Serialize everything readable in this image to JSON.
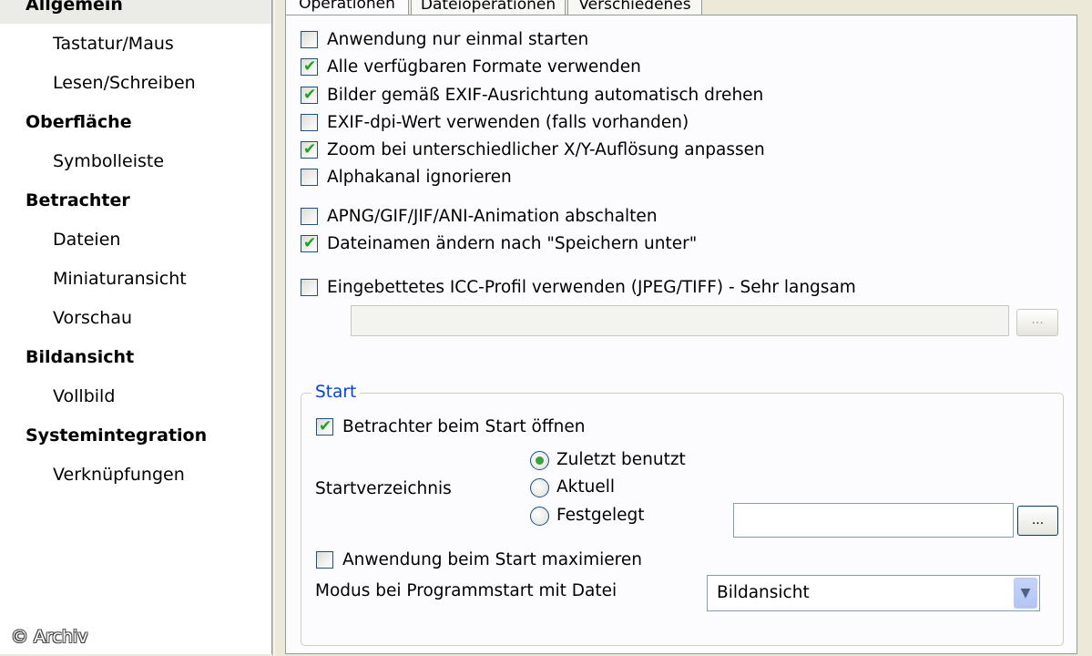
{
  "sidebar": {
    "items": [
      {
        "label": "Allgemein",
        "level": "category",
        "selected": true
      },
      {
        "label": "Tastatur/Maus",
        "level": "sub"
      },
      {
        "label": "Lesen/Schreiben",
        "level": "sub"
      },
      {
        "label": "Oberfläche",
        "level": "category"
      },
      {
        "label": "Symbolleiste",
        "level": "sub"
      },
      {
        "label": "Betrachter",
        "level": "category"
      },
      {
        "label": "Dateien",
        "level": "sub"
      },
      {
        "label": "Miniaturansicht",
        "level": "sub"
      },
      {
        "label": "Vorschau",
        "level": "sub"
      },
      {
        "label": "Bildansicht",
        "level": "category"
      },
      {
        "label": "Vollbild",
        "level": "sub"
      },
      {
        "label": "Systemintegration",
        "level": "category"
      },
      {
        "label": "Verknüpfungen",
        "level": "sub"
      }
    ]
  },
  "tabs": [
    {
      "label": "Operationen",
      "active": true
    },
    {
      "label": "Dateioperationen",
      "active": false
    },
    {
      "label": "Verschiedenes",
      "active": false
    }
  ],
  "options": [
    {
      "label": "Anwendung nur einmal starten",
      "checked": false
    },
    {
      "label": "Alle verfügbaren Formate verwenden",
      "checked": true
    },
    {
      "label": "Bilder gemäß EXIF-Ausrichtung automatisch drehen",
      "checked": true
    },
    {
      "label": "EXIF-dpi-Wert verwenden (falls vorhanden)",
      "checked": false
    },
    {
      "label": "Zoom bei unterschiedlicher X/Y-Auflösung anpassen",
      "checked": true
    },
    {
      "label": "Alphakanal ignorieren",
      "checked": false
    },
    {
      "label": "APNG/GIF/JIF/ANI-Animation abschalten",
      "checked": false
    },
    {
      "label": "Dateinamen ändern nach \"Speichern unter\"",
      "checked": true
    },
    {
      "label": "Eingebettetes ICC-Profil verwenden (JPEG/TIFF) - Sehr langsam",
      "checked": false
    }
  ],
  "icc": {
    "path_value": "",
    "browse_label": "..."
  },
  "start_group": {
    "legend": "Start",
    "open_viewer": {
      "label": "Betrachter beim Start öffnen",
      "checked": true
    },
    "startdir_label": "Startverzeichnis",
    "radios": [
      {
        "label": "Zuletzt benutzt",
        "checked": true
      },
      {
        "label": "Aktuell",
        "checked": false
      },
      {
        "label": "Festgelegt",
        "checked": false
      }
    ],
    "fixed_path_value": "",
    "fixed_browse_label": "...",
    "maximize": {
      "label": "Anwendung beim Start maximieren",
      "checked": false
    },
    "mode_label": "Modus bei Programmstart mit Datei",
    "mode_value": "Bildansicht"
  },
  "watermark": "© Archiv"
}
